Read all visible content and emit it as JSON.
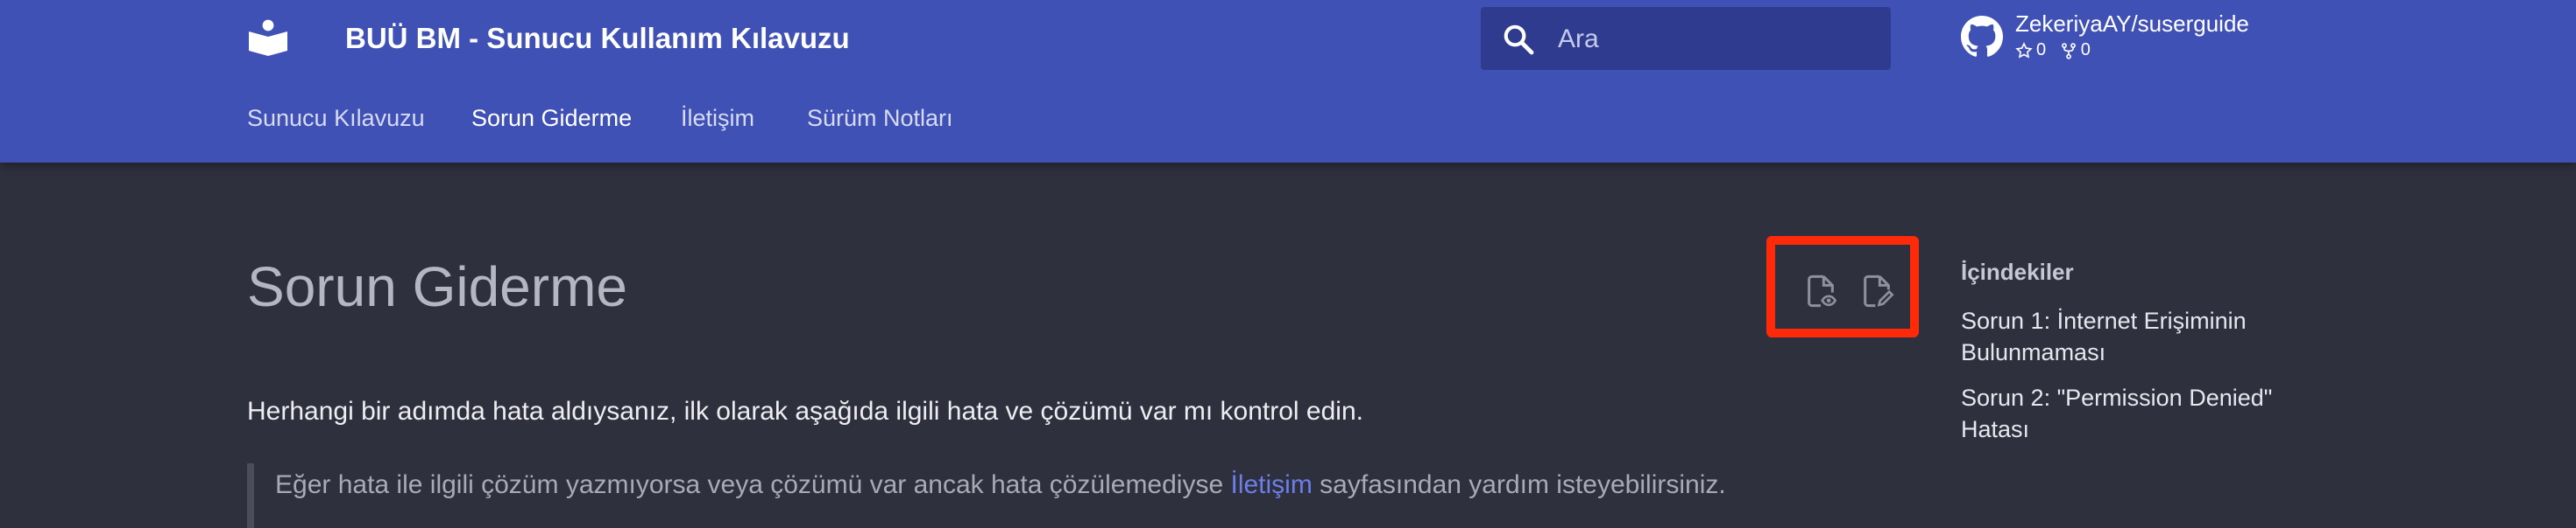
{
  "header": {
    "title": "BUÜ BM - Sunucu Kullanım Kılavuzu",
    "search_placeholder": "Ara",
    "repo": {
      "name": "ZekeriyaAY/suserguide",
      "stars": "0",
      "forks": "0"
    }
  },
  "tabs": [
    {
      "label": "Sunucu Kılavuzu",
      "active": false
    },
    {
      "label": "Sorun Giderme",
      "active": true
    },
    {
      "label": "İletişim",
      "active": false
    },
    {
      "label": "Sürüm Notları",
      "active": false
    }
  ],
  "main": {
    "title": "Sorun Giderme",
    "intro": "Herhangi bir adımda hata aldıysanız, ilk olarak aşağıda ilgili hata ve çözümü var mı kontrol edin.",
    "note_before": "Eğer hata ile ilgili çözüm yazmıyorsa veya çözümü var ancak hata çözülemediyse ",
    "note_link": "İletişim",
    "note_after": " sayfasından yardım isteyebilirsiniz."
  },
  "page_actions": {
    "view_icon": "file-view-icon",
    "edit_icon": "file-edit-icon",
    "highlight_color": "#ff2a0a"
  },
  "toc": {
    "title": "İçindekiler",
    "items": [
      "Sorun 1: İnternet Erişiminin Bulunmaması",
      "Sorun 2: \"Permission Denied\" Hatası"
    ]
  },
  "colors": {
    "header": "#4051b5",
    "background": "#2f303d",
    "link": "#6c7ee8"
  }
}
